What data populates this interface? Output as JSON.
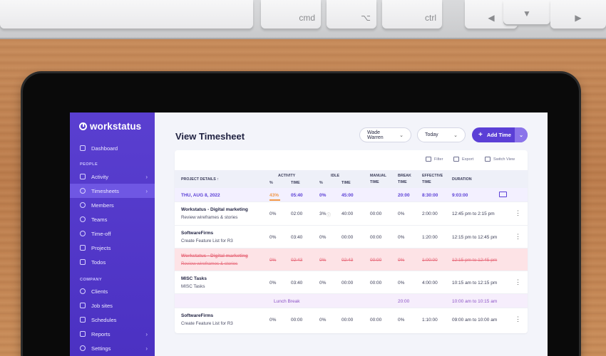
{
  "keyboard": {
    "keys": [
      "cmd",
      "⌥",
      "ctrl",
      "◀",
      "▼",
      "▶"
    ]
  },
  "app": {
    "brand": "workstatus"
  },
  "sidebar": {
    "dashboard": "Dashboard",
    "people_label": "PEOPLE",
    "people_items": [
      "Activity",
      "Timesheets",
      "Members",
      "Teams",
      "Time-off",
      "Projects",
      "Todos"
    ],
    "company_label": "COMPANY",
    "company_items": [
      "Clients",
      "Job sites",
      "Schedules",
      "Reports",
      "Settings"
    ]
  },
  "header": {
    "title": "View Timesheet",
    "user_select": "Wade Warren",
    "range_select": "Today",
    "add_button": "Add Time"
  },
  "toolbar": {
    "filter": "Filter",
    "export": "Export",
    "switch_view": "Switch View"
  },
  "table": {
    "headers": {
      "project_details": "PROJECT DETAILS ↑",
      "activity": "ACTIVITY",
      "activity_pct": "%",
      "activity_time": "TIME",
      "idle": "IDLE",
      "idle_pct": "%",
      "idle_time": "TIME",
      "manual_1": "MANUAL",
      "manual_2": "TIME",
      "break_1": "BREAK",
      "break_2": "TIME",
      "effective_1": "EFFECTIVE",
      "effective_2": "TIME",
      "duration": "DURATION"
    },
    "date_row": {
      "date": "THU, AUG 8, 2022",
      "activity_pct": "43%",
      "activity_time": "05:40",
      "idle_pct": "0%",
      "idle_time": "45:00",
      "manual": "",
      "break": "20:00",
      "effective": "8:30:00",
      "duration": "9:03:00"
    },
    "rows": [
      {
        "project": "Workstatus - Digital marketing",
        "task": "Review wireframes & stories",
        "activity_pct": "0%",
        "activity_time": "02:00",
        "idle_pct": "3%",
        "idle_time": "40:00",
        "manual": "00:00",
        "break": "0%",
        "effective": "2:00:00",
        "duration": "12:45 pm to 2:15 pm"
      },
      {
        "project": "SoftwareFirms",
        "task": "Create Feature List for R3",
        "activity_pct": "0%",
        "activity_time": "03:40",
        "idle_pct": "0%",
        "idle_time": "00:00",
        "manual": "00:00",
        "break": "0%",
        "effective": "1:20:00",
        "duration": "12:15 pm to 12:45 pm"
      },
      {
        "project": "Workstatus - Digital marketing",
        "task": "Review wireframes & stories",
        "activity_pct": "0%",
        "activity_time": "02:43",
        "idle_pct": "0%",
        "idle_time": "02:43",
        "manual": "00:00",
        "break": "0%",
        "effective": "1:00:00",
        "duration": "12:15 pm to 12:45 pm"
      },
      {
        "project": "MISC Tasks",
        "task": "MISC Tasks",
        "activity_pct": "0%",
        "activity_time": "03:40",
        "idle_pct": "0%",
        "idle_time": "00:00",
        "manual": "00:00",
        "break": "0%",
        "effective": "4:00:00",
        "duration": "10:15 am to 12:15 pm"
      },
      {
        "project": "SoftwareFirms",
        "task": "Create Feature List for R3",
        "activity_pct": "0%",
        "activity_time": "00:00",
        "idle_pct": "0%",
        "idle_time": "00:00",
        "manual": "00:00",
        "break": "0%",
        "effective": "1:10:00",
        "duration": "09:00 am to 10:00 am"
      }
    ],
    "break_row": {
      "label": "Lunch Break",
      "break": "20:00",
      "duration": "10:00 am to 10:15 am"
    }
  },
  "colors": {
    "accent": "#5b3fd6",
    "sidebar": "#4b31c2",
    "deleted_row": "#fde3e6",
    "break_row": "#f6eefc",
    "activity_bar": "#f2994a"
  }
}
